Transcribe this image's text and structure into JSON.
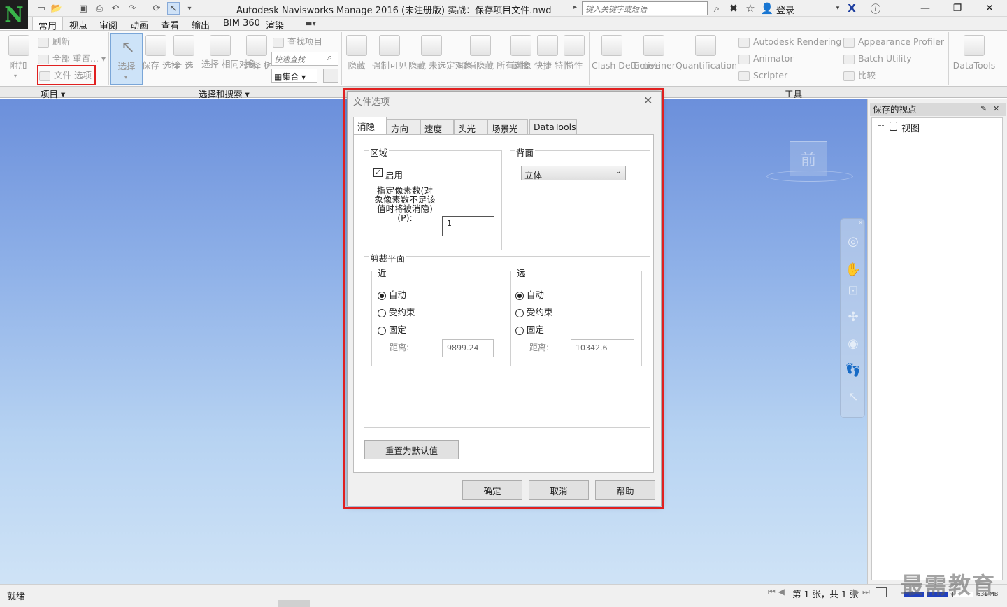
{
  "window": {
    "title": "Autodesk Navisworks Manage 2016 (未注册版)    实战：保存项目文件.nwd",
    "search_placeholder": "键入关键字或短语",
    "login_label": "登录"
  },
  "tabs": [
    "常用",
    "视点",
    "审阅",
    "动画",
    "查看",
    "输出",
    "BIM 360",
    "渲染"
  ],
  "ribbon": {
    "project": {
      "append": "附加",
      "refresh": "刷新",
      "reset_all": "全部 重置...",
      "file_options": "文件 选项",
      "panel_title": "项目 ▾"
    },
    "select_search": {
      "select": "选择",
      "save_selection": "保存 选择",
      "select_all": "全 选",
      "select_same": "选择 相同对象",
      "selection_tree": "选择 树",
      "find_items": "查找项目",
      "quick_find_placeholder": "快速查找",
      "sets_label": "集合",
      "panel_title": "选择和搜索 ▾"
    },
    "visibility": {
      "hide": "隐藏",
      "require": "强制可见",
      "hide_unselected": "隐藏 未选定对象",
      "unhide_all": "取消隐藏 所有对象"
    },
    "display": {
      "links": "链接",
      "quick_properties": "快捷 特性",
      "properties": "特性"
    },
    "tools": {
      "clash_detective": "Clash Detective",
      "timeliner": "TimeLiner",
      "quantification": "Quantification",
      "autodesk_rendering": "Autodesk Rendering",
      "animator": "Animator",
      "scripter": "Scripter",
      "appearance_profiler": "Appearance Profiler",
      "batch_utility": "Batch Utility",
      "compare": "比较",
      "datatools": "DataTools",
      "panel_title": "工具"
    }
  },
  "viewcube": {
    "face_label": "前"
  },
  "saved_viewpoints": {
    "title": "保存的视点",
    "root_item": "视图"
  },
  "statusbar": {
    "status": "就绪",
    "page_info": "第 1 张，共 1 张",
    "memory": "631 MB"
  },
  "watermark": "最需教育",
  "dialog": {
    "title": "文件选项",
    "tabs": [
      "消隐",
      "方向",
      "速度",
      "头光源",
      "场景光源",
      "DataTools"
    ],
    "active_tab": "消隐",
    "area": {
      "group_label": "区域",
      "enable_label": "启用",
      "enabled": true,
      "pixel_label": "指定像素数(对象像素数不足该值时将被消隐)(P):",
      "pixel_value": "1"
    },
    "backface": {
      "group_label": "背面",
      "selected": "立体"
    },
    "clipping": {
      "group_label": "剪裁平面",
      "near": {
        "label": "近",
        "options": [
          "自动",
          "受约束",
          "固定"
        ],
        "selected": "自动",
        "distance_label": "距离:",
        "distance_value": "9899.24"
      },
      "far": {
        "label": "远",
        "options": [
          "自动",
          "受约束",
          "固定"
        ],
        "selected": "自动",
        "distance_label": "距离:",
        "distance_value": "10342.6"
      }
    },
    "reset_button": "重置为默认值",
    "ok_button": "确定",
    "cancel_button": "取消",
    "help_button": "帮助"
  },
  "colors": {
    "highlight_box": "#e02020",
    "viewport_top": "#6b8fdb",
    "viewport_bottom": "#cfe3f6"
  }
}
